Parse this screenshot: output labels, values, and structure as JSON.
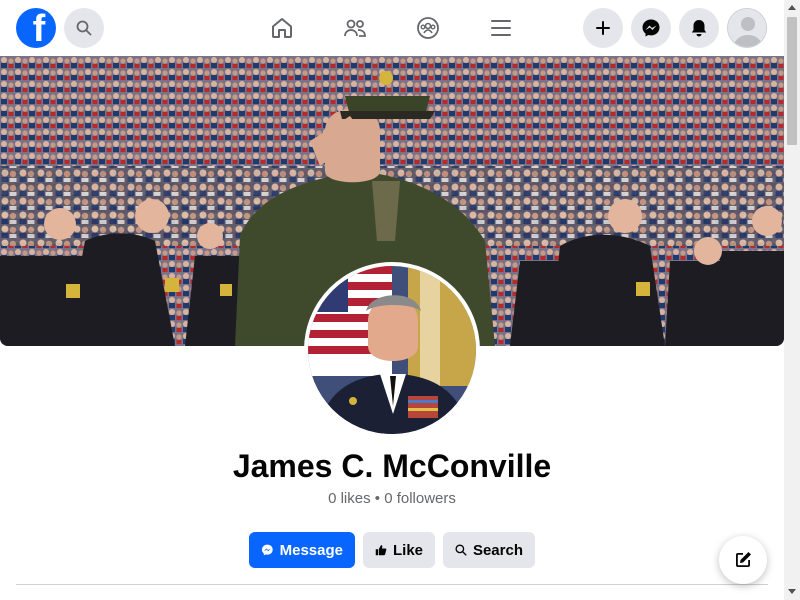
{
  "header": {
    "logo_letter": "f",
    "nav_icons": [
      "home-icon",
      "friends-icon",
      "groups-icon",
      "menu-icon"
    ],
    "right_icons": [
      "plus-icon",
      "messenger-icon",
      "bell-icon",
      "avatar"
    ]
  },
  "profile": {
    "name": "James C. McConville",
    "stats": "0 likes • 0 followers"
  },
  "actions": {
    "message_label": "Message",
    "like_label": "Like",
    "search_label": "Search"
  },
  "colors": {
    "brand_blue": "#0866ff",
    "secondary_bg": "#e4e6eb",
    "text_primary": "#050505",
    "text_secondary": "#65676b"
  }
}
